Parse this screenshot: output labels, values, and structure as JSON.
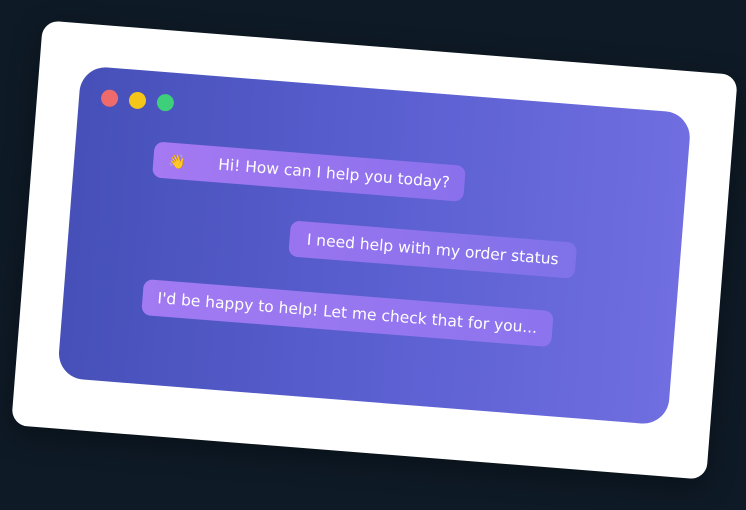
{
  "window": {
    "controls": [
      {
        "name": "close",
        "color": "#ef6b6b"
      },
      {
        "name": "minimize",
        "color": "#f5c518"
      },
      {
        "name": "maximize",
        "color": "#3ecf7a"
      }
    ]
  },
  "chat": {
    "messages": [
      {
        "sender": "bot",
        "emoji": "👋",
        "text": "Hi! How can I help you today?"
      },
      {
        "sender": "user",
        "text": "I need help with my order status"
      },
      {
        "sender": "bot",
        "text": "I'd be happy to help! Let me check that for you..."
      }
    ]
  },
  "colors": {
    "background": "#0e1a26",
    "card": "#ffffff",
    "window_gradient_start": "#4650b8",
    "window_gradient_end": "#706ee0",
    "bubble_accent": "#a579f2"
  }
}
